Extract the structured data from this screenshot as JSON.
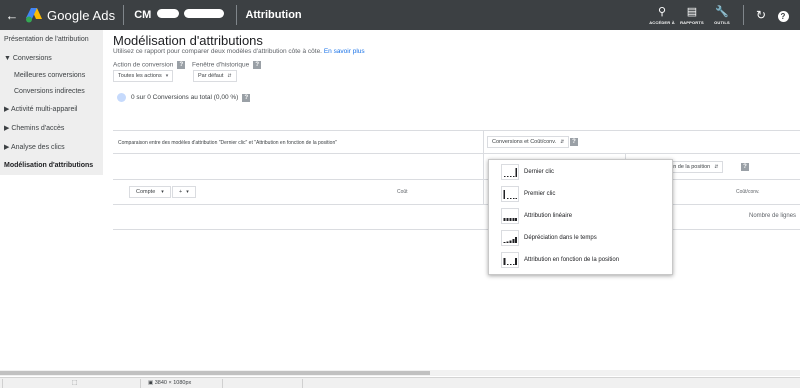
{
  "header": {
    "back_icon": "arrow-left-icon",
    "logo_text": "Google Ads",
    "account_prefix": "CM",
    "page_title": "Attribution",
    "actions": [
      {
        "icon": "search-icon",
        "label": "ACCÉDER À"
      },
      {
        "icon": "reports-icon",
        "label": "RAPPORTS"
      },
      {
        "icon": "wrench-icon",
        "label": "OUTILS"
      }
    ],
    "refresh_icon": "refresh-icon",
    "help_icon": "help-icon"
  },
  "sidebar": {
    "items": [
      {
        "label": "Présentation de l'attribution"
      },
      {
        "label": "▼ Conversions"
      },
      {
        "label": "Meilleures conversions"
      },
      {
        "label": "Conversions indirectes"
      },
      {
        "label": "▶ Activité multi-appareil"
      },
      {
        "label": "▶ Chemins d'accès"
      },
      {
        "label": "▶ Analyse des clics"
      },
      {
        "label": "Modélisation d'attributions"
      }
    ]
  },
  "main": {
    "title": "Modélisation d'attributions",
    "description": "Utilisez ce rapport pour comparer deux modèles d'attribution côte à côte.",
    "learn_more": "En savoir plus",
    "conversion_action_label": "Action de conversion",
    "history_window_label": "Fenêtre d'historique",
    "conversion_action_value": "Toutes les actions",
    "history_window_value": "Par défaut",
    "stats_text": "0 sur 0 Conversions au total (0,00 %)",
    "comparison_text": "Comparaison entre des modèles d'attribution \"Dernier clic\" et \"Attribution en fonction de la position\"",
    "metric_select": "Conversions et Coût/conv.",
    "model_select": "fonction de la position",
    "account_button": "Compte",
    "add_button": "+",
    "col_cost": "Coût",
    "col_cost_conv": "Coût/conv.",
    "rows_label": "Nombre de lignes",
    "help_mark": "?"
  },
  "menu": {
    "items": [
      {
        "label": "Dernier clic",
        "icon": "last-click-icon"
      },
      {
        "label": "Premier clic",
        "icon": "first-click-icon"
      },
      {
        "label": "Attribution linéaire",
        "icon": "linear-icon"
      },
      {
        "label": "Dépréciation dans le temps",
        "icon": "time-decay-icon"
      },
      {
        "label": "Attribution en fonction de la position",
        "icon": "position-based-icon"
      }
    ]
  },
  "statusbar": {
    "resolution": "3840 × 1080px"
  }
}
